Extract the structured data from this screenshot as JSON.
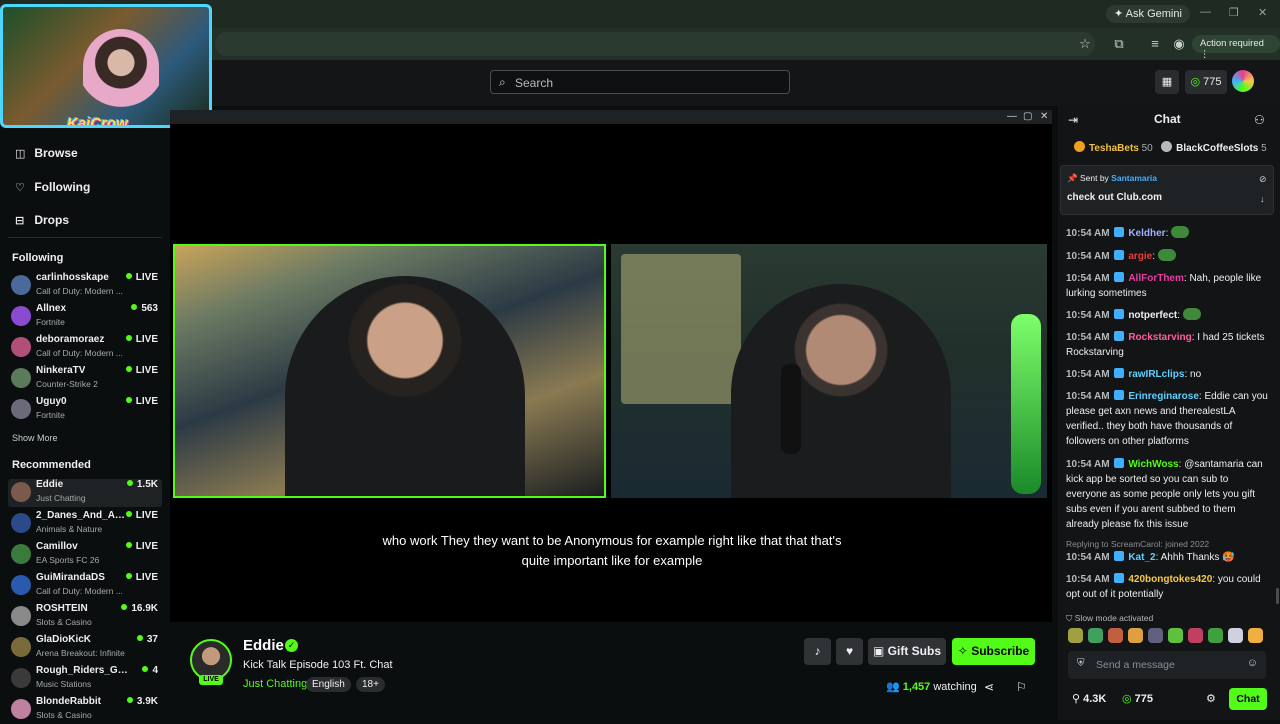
{
  "browser": {
    "ask_gemini": "Ask Gemini",
    "action_required": "Action required"
  },
  "header": {
    "search_placeholder": "Search",
    "points": "775"
  },
  "pip": {
    "logo": "KaiCrow"
  },
  "sidebar": {
    "nav": [
      {
        "label": "Browse",
        "icon": "compass-icon"
      },
      {
        "label": "Following",
        "icon": "heart-icon"
      },
      {
        "label": "Drops",
        "icon": "drops-icon"
      }
    ],
    "following_title": "Following",
    "following": [
      {
        "name": "carlinhosskape",
        "category": "Call of Duty: Modern ...",
        "stat": "LIVE",
        "color": "#4b6a9b"
      },
      {
        "name": "Allnex",
        "category": "Fortnite",
        "stat": "563",
        "color": "#8a4bd0"
      },
      {
        "name": "deboramoraez",
        "category": "Call of Duty: Modern ...",
        "stat": "LIVE",
        "color": "#b0507a"
      },
      {
        "name": "NinkeraTV",
        "category": "Counter-Strike 2",
        "stat": "LIVE",
        "color": "#5a7a5a"
      },
      {
        "name": "Uguy0",
        "category": "Fortnite",
        "stat": "LIVE",
        "color": "#6a6a7a"
      }
    ],
    "show_more": "Show More",
    "recommended_title": "Recommended",
    "recommended": [
      {
        "name": "Eddie",
        "category": "Just Chatting",
        "stat": "1.5K",
        "color": "#7a5a4a"
      },
      {
        "name": "2_Danes_And_An...",
        "category": "Animals & Nature",
        "stat": "LIVE",
        "color": "#2a4a8a"
      },
      {
        "name": "Camillov",
        "category": "EA Sports FC 26",
        "stat": "LIVE",
        "color": "#3a7a3a"
      },
      {
        "name": "GuiMirandaDS",
        "category": "Call of Duty: Modern ...",
        "stat": "LIVE",
        "color": "#2a5ab0"
      },
      {
        "name": "ROSHTEIN",
        "category": "Slots & Casino",
        "stat": "16.9K",
        "color": "#8a8a8a"
      },
      {
        "name": "GlaDioKicK",
        "category": "Arena Breakout: Infinite",
        "stat": "37",
        "color": "#7a6a3a"
      },
      {
        "name": "Rough_Riders_Gaming",
        "category": "Music Stations",
        "stat": "4",
        "color": "#3a3a3a"
      },
      {
        "name": "BlondeRabbit",
        "category": "Slots & Casino",
        "stat": "3.9K",
        "color": "#c080a0"
      }
    ]
  },
  "player": {
    "caption_line1": "who work They they want to be Anonymous for example right like that that that's",
    "caption_line2": "quite important like for example"
  },
  "stream": {
    "name": "Eddie",
    "title": "Kick Talk Episode 103 Ft. Chat",
    "category": "Just Chatting",
    "tags": [
      "English",
      "18+"
    ],
    "live": "LIVE",
    "gift_subs": "Gift Subs",
    "subscribe": "Subscribe",
    "viewers": "1,457",
    "watching": "watching"
  },
  "chat": {
    "title": "Chat",
    "gifters": [
      {
        "name": "TeshaBets",
        "count": "50",
        "color": "#f0a020"
      },
      {
        "name": "BlackCoffeeSlots",
        "count": "5",
        "color": "#b6babd"
      }
    ],
    "pinned": {
      "sent_by": "Sent by",
      "user": "Santamaria",
      "message": "check out Club.com"
    },
    "messages": [
      {
        "ts": "10:54 AM",
        "user": "Keldher",
        "color": "#a0b0ff",
        "text": "",
        "emote": true
      },
      {
        "ts": "10:54 AM",
        "user": "argie",
        "color": "#e83e3e",
        "text": "",
        "emote": true
      },
      {
        "ts": "10:54 AM",
        "user": "AllForThem",
        "color": "#e83ea4",
        "text": "Nah, people like lurking sometimes"
      },
      {
        "ts": "10:54 AM",
        "user": "notperfect",
        "color": "#efeff1",
        "text": "",
        "emote": true
      },
      {
        "ts": "10:54 AM",
        "user": "Rockstarving",
        "color": "#ff5fa0",
        "text": "I had 25 tickets Rockstarving"
      },
      {
        "ts": "10:54 AM",
        "user": "rawIRLclips",
        "color": "#5fd0ff",
        "text": "no"
      },
      {
        "ts": "10:54 AM",
        "user": "Erinreginarose",
        "color": "#5fd0ff",
        "text": "Eddie can you please get axn news and therealestLA verified.. they both have thousands of followers on other platforms"
      },
      {
        "ts": "10:54 AM",
        "user": "WichWoss",
        "color": "#53fc18",
        "text": "@santamaria can kick app be sorted so you can sub to everyone as some people only lets you gift subs even if you arent subbed to them already please fix this issue"
      },
      {
        "ts": "10:54 AM",
        "user": "Kat_2",
        "color": "#5fd0ff",
        "text": "Ahhh Thanks 🥵"
      },
      {
        "ts": "10:54 AM",
        "user": "420bongtokes420",
        "color": "#f7c948",
        "text": "you could opt out of it potentially"
      }
    ],
    "reply_note": "Replying to ScreamCarol: joined 2022",
    "slow_mode": "Slow mode activated",
    "input_placeholder": "Send a message",
    "footer_followers": "4.3K",
    "footer_points": "775",
    "chat_button": "Chat"
  }
}
